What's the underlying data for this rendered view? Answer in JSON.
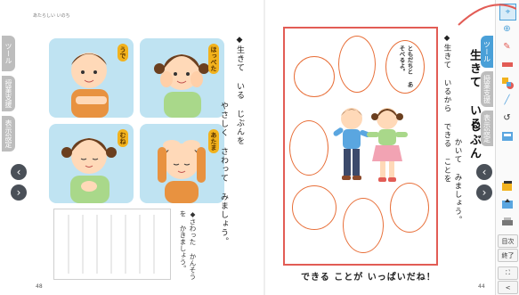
{
  "header": {
    "running_title": "あたらしい いのち"
  },
  "side_tabs_left": [
    "ツール",
    "授業支援",
    "表示設定"
  ],
  "side_tabs_mid": [
    "ツール",
    "授業支援",
    "表示設定"
  ],
  "cards": [
    {
      "label": "うで"
    },
    {
      "label": "ほっぺた"
    },
    {
      "label": "むね"
    },
    {
      "label": "あたま"
    }
  ],
  "left_page": {
    "heading_lines": [
      "◆生きて いる じぶんを",
      "やさしく さわって みましょう。"
    ],
    "note": "◆さわった かんそうを かきましょう。",
    "page_number": "48"
  },
  "right_page": {
    "title_lines": [
      "生きて いる",
      "じぶん"
    ],
    "instruction_lines": [
      "◆生きて いるから できる ことを",
      "かいて みましょう。"
    ],
    "speech_bubble": "ともだちと あそべるよ。",
    "footer": "できる ことが いっぱいだね！",
    "page_number": "44"
  },
  "toolbar": {
    "tools": [
      "pointer-icon",
      "zoom-icon",
      "pen-icon",
      "marker-icon",
      "shapes-icon",
      "highlighter-icon",
      "undo-icon",
      "mask-icon",
      "sticky-icon",
      "export-icon",
      "print-icon"
    ],
    "contents_label": "目次",
    "exit_label": "終了",
    "fullscreen_label": "⛶",
    "page_label": "<"
  },
  "nav": {
    "prev": "‹",
    "next": "›"
  },
  "colors": {
    "accent": "#e8703a",
    "card_bg": "#bfe3f2",
    "label": "#f2b21d",
    "frame": "#e25c55",
    "bullet": "#5aa6e0"
  }
}
